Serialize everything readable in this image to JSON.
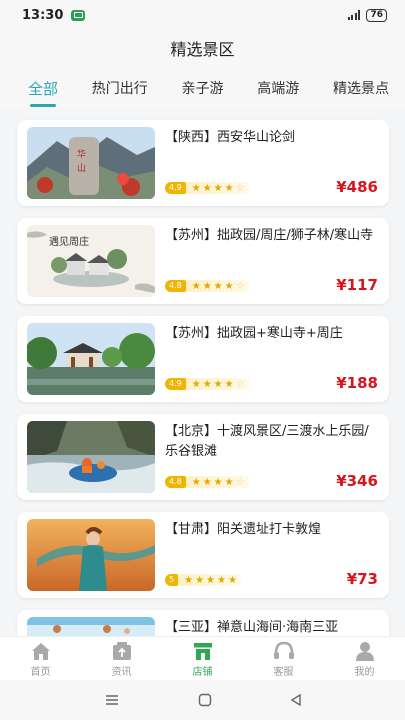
{
  "status_bar": {
    "time": "13:30",
    "battery": "76"
  },
  "header": {
    "title": "精选景区"
  },
  "tabs": [
    {
      "label": "全部",
      "active": true
    },
    {
      "label": "热门出行",
      "active": false
    },
    {
      "label": "亲子游",
      "active": false
    },
    {
      "label": "高端游",
      "active": false
    },
    {
      "label": "精选景点",
      "active": false
    }
  ],
  "items": [
    {
      "title": "【陕西】西安华山论剑",
      "rating": "4.9",
      "stars": 4,
      "price": "¥486",
      "image": "mountain-stele"
    },
    {
      "title": "【苏州】拙政园/周庄/狮子林/寒山寺",
      "rating": "4.8",
      "stars": 4,
      "price": "¥117",
      "image": "ink-painting-garden",
      "image_text": "遇见周庄"
    },
    {
      "title": "【苏州】拙政园+寒山寺+周庄",
      "rating": "4.9",
      "stars": 4,
      "price": "¥188",
      "image": "garden-pavilion"
    },
    {
      "title": "【北京】十渡风景区/三渡水上乐园/乐谷银滩",
      "rating": "4.8",
      "stars": 4,
      "price": "¥346",
      "image": "river-rafting"
    },
    {
      "title": "【甘肃】阳关遗址打卡敦煌",
      "rating": "5",
      "stars": 5,
      "price": "¥73",
      "image": "dunhuang-dancer"
    },
    {
      "title": "【三亚】禅意山海间·海南三亚",
      "rating": "",
      "stars": 0,
      "price": "",
      "image": "beach"
    }
  ],
  "bottom_nav": [
    {
      "label": "首页",
      "icon": "home-icon",
      "active": false
    },
    {
      "label": "资讯",
      "icon": "news-icon",
      "active": false
    },
    {
      "label": "店铺",
      "icon": "store-icon",
      "active": true
    },
    {
      "label": "客服",
      "icon": "headset-icon",
      "active": false
    },
    {
      "label": "我的",
      "icon": "user-icon",
      "active": false
    }
  ],
  "colors": {
    "accent": "#2aa8b8",
    "price": "#d8141c",
    "nav_active": "#2fa84f",
    "rating": "#f2b400"
  }
}
